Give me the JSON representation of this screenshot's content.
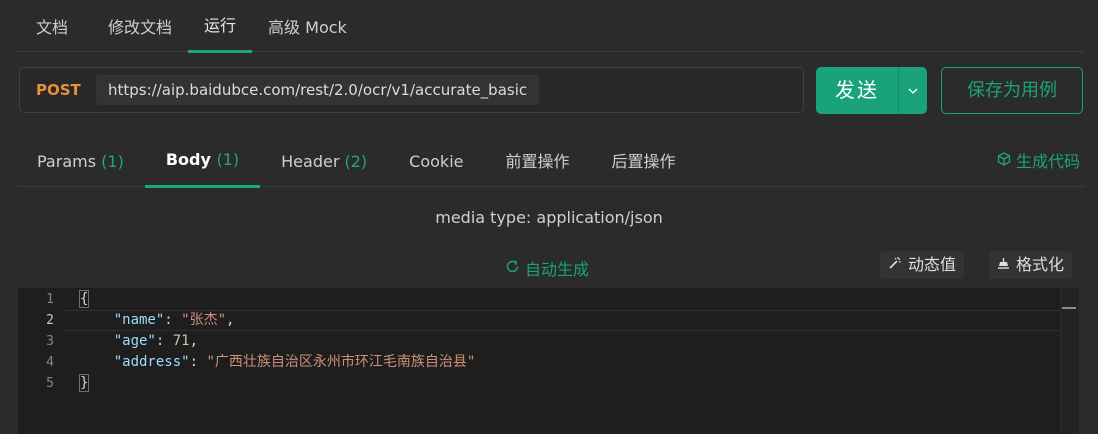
{
  "top_tabs": [
    {
      "label": "文档"
    },
    {
      "label": "修改文档"
    },
    {
      "label": "运行",
      "active": true
    },
    {
      "label": "高级 Mock"
    }
  ],
  "request": {
    "method": "POST",
    "url": "https://aip.baidubce.com/rest/2.0/ocr/v1/accurate_basic",
    "send_label": "发送",
    "save_label": "保存为用例"
  },
  "sub_tabs": [
    {
      "label": "Params",
      "count": "(1)"
    },
    {
      "label": "Body",
      "count": "(1)",
      "active": true
    },
    {
      "label": "Header",
      "count": "(2)"
    },
    {
      "label": "Cookie",
      "count": ""
    },
    {
      "label": "前置操作",
      "count": ""
    },
    {
      "label": "后置操作",
      "count": ""
    }
  ],
  "generate_code_label": "生成代码",
  "media_type_text": "media type: application/json",
  "auto_generate_label": "自动生成",
  "dynamic_value_label": "动态值",
  "format_label": "格式化",
  "editor": {
    "line_numbers": [
      "1",
      "2",
      "3",
      "4",
      "5"
    ],
    "current_line": 2,
    "lines": {
      "l1": "{",
      "l2_key": "\"name\"",
      "l2_val": "\"张杰\"",
      "l3_key": "\"age\"",
      "l3_val": "71",
      "l4_key": "\"address\"",
      "l4_val": "\"广西壮族自治区永州市环江毛南族自治县\"",
      "l5": "}"
    }
  },
  "colors": {
    "accent": "#1aa37a",
    "method_post": "#e88f3c",
    "background": "#2b2b2b",
    "editor_bg": "#1e1e1e"
  },
  "icons": {
    "send_dropdown": "chevron-down-icon",
    "generate_code": "cube-icon",
    "auto_generate": "refresh-icon",
    "dynamic_value": "magic-wand-icon",
    "format": "format-icon"
  }
}
